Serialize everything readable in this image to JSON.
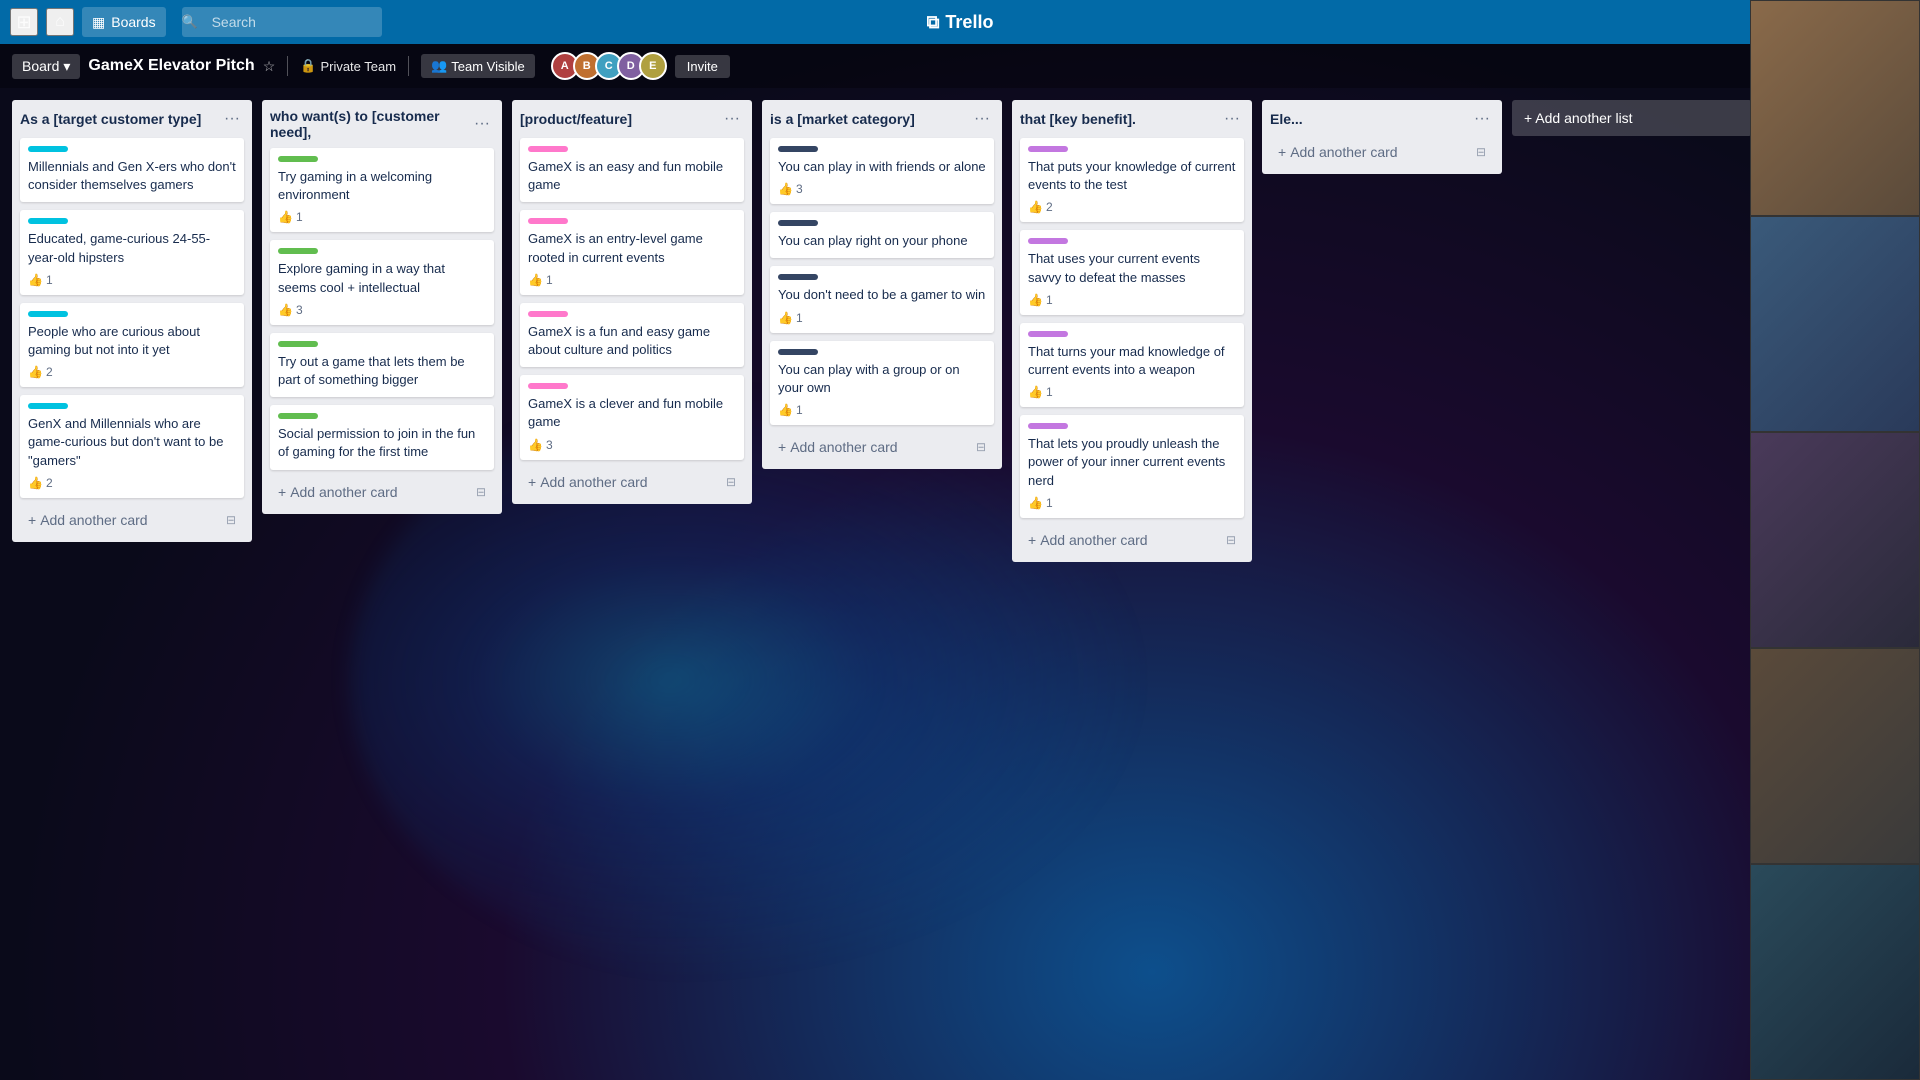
{
  "topnav": {
    "boards_label": "Boards",
    "search_placeholder": "Search",
    "logo_text": "Trello"
  },
  "boardbar": {
    "board_label": "Board",
    "title": "GameX Elevator Pitch",
    "private_label": "Private Team",
    "team_label": "Team Visible",
    "invite_label": "Invite"
  },
  "columns": [
    {
      "title": "As a [target customer type]",
      "cards": [
        {
          "label_color": "cyan",
          "text": "Millennials and Gen X-ers who don't consider themselves gamers",
          "votes": null
        },
        {
          "label_color": "cyan",
          "text": "Educated, game-curious 24-55-year-old hipsters",
          "votes": 1
        },
        {
          "label_color": "cyan",
          "text": "People who are curious about gaming but not into it yet",
          "votes": 2
        },
        {
          "label_color": "cyan",
          "text": "GenX and Millennials who are game-curious but don't want to be \"gamers\"",
          "votes": 2
        }
      ],
      "add_card": "+ Add another card"
    },
    {
      "title": "who want(s) to [customer need],",
      "cards": [
        {
          "label_color": "green",
          "text": "Try gaming in a welcoming environment",
          "votes": 1
        },
        {
          "label_color": "green",
          "text": "Explore gaming in a way that seems cool + intellectual",
          "votes": 3
        },
        {
          "label_color": "green",
          "text": "Try out a game that lets them be part of something bigger",
          "votes": null
        },
        {
          "label_color": "green",
          "text": "Social permission to join in the fun of gaming for the first time",
          "votes": null
        }
      ],
      "add_card": "+ Add another card"
    },
    {
      "title": "[product/feature]",
      "cards": [
        {
          "label_color": "pink",
          "text": "GameX is an easy and fun mobile game",
          "votes": null
        },
        {
          "label_color": "pink",
          "text": "GameX is an entry-level game rooted in current events",
          "votes": 1
        },
        {
          "label_color": "pink",
          "text": "GameX is a fun and easy game about culture and politics",
          "votes": null
        },
        {
          "label_color": "pink",
          "text": "GameX is a clever and fun mobile game",
          "votes": 3
        }
      ],
      "add_card": "+ Add another card"
    },
    {
      "title": "is a [market category]",
      "cards": [
        {
          "label_color": "dark-blue",
          "text": "You can play in with friends or alone",
          "votes": 3
        },
        {
          "label_color": "dark-blue",
          "text": "You can play right on your phone",
          "votes": null
        },
        {
          "label_color": "dark-blue",
          "text": "You don't need to be a gamer to win",
          "votes": 1
        },
        {
          "label_color": "dark-blue",
          "text": "You can play with a group or on your own",
          "votes": 1
        }
      ],
      "add_card": "+ Add another card"
    },
    {
      "title": "that [key benefit].",
      "cards": [
        {
          "label_color": "purple",
          "text": "That puts your knowledge of current events to the test",
          "votes": 2
        },
        {
          "label_color": "purple",
          "text": "That uses your current events savvy to defeat the masses",
          "votes": 1
        },
        {
          "label_color": "purple",
          "text": "That turns your mad knowledge of current events into a weapon",
          "votes": 1
        },
        {
          "label_color": "purple",
          "text": "That lets you proudly unleash the power of your inner current events nerd",
          "votes": 1
        }
      ],
      "add_card": "+ Add another card"
    },
    {
      "title": "Ele...",
      "cards": [],
      "add_card": "+ Add another card"
    }
  ],
  "add_column_label": "+ Add another list",
  "avatars": [
    {
      "color": "#b04040",
      "label": "A"
    },
    {
      "color": "#4070b0",
      "label": "B"
    },
    {
      "color": "#40a0b0",
      "label": "C"
    },
    {
      "color": "#8040b0",
      "label": "D"
    },
    {
      "color": "#b08040",
      "label": "E"
    }
  ]
}
